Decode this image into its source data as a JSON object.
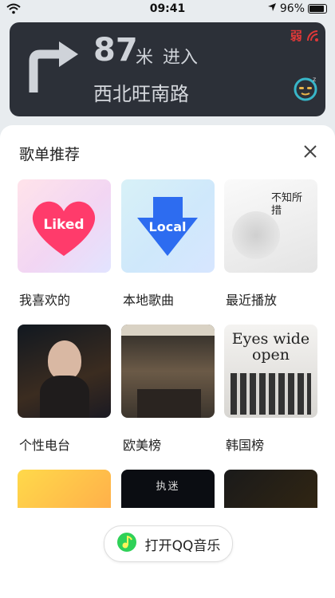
{
  "status": {
    "time": "09:41",
    "battery": "96%",
    "battery_level": 0.96
  },
  "nav": {
    "distance": "87",
    "unit": "米",
    "action": "进入",
    "road": "西北旺南路",
    "signal": "弱"
  },
  "sheet": {
    "title": "歌单推荐",
    "items": [
      {
        "label": "我喜欢的",
        "badge": "Liked"
      },
      {
        "label": "本地歌曲",
        "badge": "Local"
      },
      {
        "label": "最近播放",
        "badge": "不知所措"
      },
      {
        "label": "个性电台"
      },
      {
        "label": "欧美榜"
      },
      {
        "label": "韩国榜",
        "badge": "Eyes wide open"
      },
      {
        "label": ""
      },
      {
        "label": "",
        "badge": "执迷"
      },
      {
        "label": ""
      }
    ],
    "open_button": "打开QQ音乐"
  },
  "colors": {
    "liked_heart": "#ff3b6b",
    "local_arrow": "#2d6cf0",
    "qq_icon": "#2fd158",
    "signal": "#e03838"
  }
}
